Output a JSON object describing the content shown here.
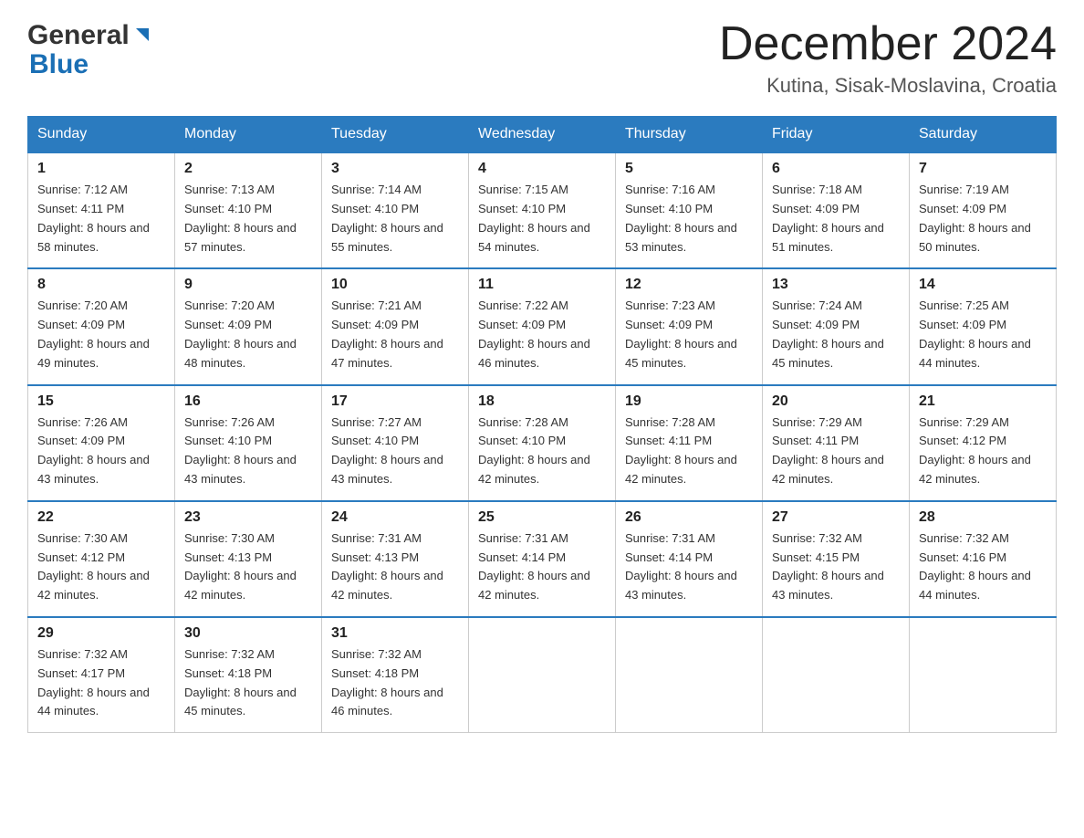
{
  "header": {
    "month_title": "December 2024",
    "location": "Kutina, Sisak-Moslavina, Croatia",
    "logo_general": "General",
    "logo_blue": "Blue"
  },
  "days_of_week": [
    "Sunday",
    "Monday",
    "Tuesday",
    "Wednesday",
    "Thursday",
    "Friday",
    "Saturday"
  ],
  "weeks": [
    [
      {
        "num": "1",
        "sunrise": "Sunrise: 7:12 AM",
        "sunset": "Sunset: 4:11 PM",
        "daylight": "Daylight: 8 hours and 58 minutes."
      },
      {
        "num": "2",
        "sunrise": "Sunrise: 7:13 AM",
        "sunset": "Sunset: 4:10 PM",
        "daylight": "Daylight: 8 hours and 57 minutes."
      },
      {
        "num": "3",
        "sunrise": "Sunrise: 7:14 AM",
        "sunset": "Sunset: 4:10 PM",
        "daylight": "Daylight: 8 hours and 55 minutes."
      },
      {
        "num": "4",
        "sunrise": "Sunrise: 7:15 AM",
        "sunset": "Sunset: 4:10 PM",
        "daylight": "Daylight: 8 hours and 54 minutes."
      },
      {
        "num": "5",
        "sunrise": "Sunrise: 7:16 AM",
        "sunset": "Sunset: 4:10 PM",
        "daylight": "Daylight: 8 hours and 53 minutes."
      },
      {
        "num": "6",
        "sunrise": "Sunrise: 7:18 AM",
        "sunset": "Sunset: 4:09 PM",
        "daylight": "Daylight: 8 hours and 51 minutes."
      },
      {
        "num": "7",
        "sunrise": "Sunrise: 7:19 AM",
        "sunset": "Sunset: 4:09 PM",
        "daylight": "Daylight: 8 hours and 50 minutes."
      }
    ],
    [
      {
        "num": "8",
        "sunrise": "Sunrise: 7:20 AM",
        "sunset": "Sunset: 4:09 PM",
        "daylight": "Daylight: 8 hours and 49 minutes."
      },
      {
        "num": "9",
        "sunrise": "Sunrise: 7:20 AM",
        "sunset": "Sunset: 4:09 PM",
        "daylight": "Daylight: 8 hours and 48 minutes."
      },
      {
        "num": "10",
        "sunrise": "Sunrise: 7:21 AM",
        "sunset": "Sunset: 4:09 PM",
        "daylight": "Daylight: 8 hours and 47 minutes."
      },
      {
        "num": "11",
        "sunrise": "Sunrise: 7:22 AM",
        "sunset": "Sunset: 4:09 PM",
        "daylight": "Daylight: 8 hours and 46 minutes."
      },
      {
        "num": "12",
        "sunrise": "Sunrise: 7:23 AM",
        "sunset": "Sunset: 4:09 PM",
        "daylight": "Daylight: 8 hours and 45 minutes."
      },
      {
        "num": "13",
        "sunrise": "Sunrise: 7:24 AM",
        "sunset": "Sunset: 4:09 PM",
        "daylight": "Daylight: 8 hours and 45 minutes."
      },
      {
        "num": "14",
        "sunrise": "Sunrise: 7:25 AM",
        "sunset": "Sunset: 4:09 PM",
        "daylight": "Daylight: 8 hours and 44 minutes."
      }
    ],
    [
      {
        "num": "15",
        "sunrise": "Sunrise: 7:26 AM",
        "sunset": "Sunset: 4:09 PM",
        "daylight": "Daylight: 8 hours and 43 minutes."
      },
      {
        "num": "16",
        "sunrise": "Sunrise: 7:26 AM",
        "sunset": "Sunset: 4:10 PM",
        "daylight": "Daylight: 8 hours and 43 minutes."
      },
      {
        "num": "17",
        "sunrise": "Sunrise: 7:27 AM",
        "sunset": "Sunset: 4:10 PM",
        "daylight": "Daylight: 8 hours and 43 minutes."
      },
      {
        "num": "18",
        "sunrise": "Sunrise: 7:28 AM",
        "sunset": "Sunset: 4:10 PM",
        "daylight": "Daylight: 8 hours and 42 minutes."
      },
      {
        "num": "19",
        "sunrise": "Sunrise: 7:28 AM",
        "sunset": "Sunset: 4:11 PM",
        "daylight": "Daylight: 8 hours and 42 minutes."
      },
      {
        "num": "20",
        "sunrise": "Sunrise: 7:29 AM",
        "sunset": "Sunset: 4:11 PM",
        "daylight": "Daylight: 8 hours and 42 minutes."
      },
      {
        "num": "21",
        "sunrise": "Sunrise: 7:29 AM",
        "sunset": "Sunset: 4:12 PM",
        "daylight": "Daylight: 8 hours and 42 minutes."
      }
    ],
    [
      {
        "num": "22",
        "sunrise": "Sunrise: 7:30 AM",
        "sunset": "Sunset: 4:12 PM",
        "daylight": "Daylight: 8 hours and 42 minutes."
      },
      {
        "num": "23",
        "sunrise": "Sunrise: 7:30 AM",
        "sunset": "Sunset: 4:13 PM",
        "daylight": "Daylight: 8 hours and 42 minutes."
      },
      {
        "num": "24",
        "sunrise": "Sunrise: 7:31 AM",
        "sunset": "Sunset: 4:13 PM",
        "daylight": "Daylight: 8 hours and 42 minutes."
      },
      {
        "num": "25",
        "sunrise": "Sunrise: 7:31 AM",
        "sunset": "Sunset: 4:14 PM",
        "daylight": "Daylight: 8 hours and 42 minutes."
      },
      {
        "num": "26",
        "sunrise": "Sunrise: 7:31 AM",
        "sunset": "Sunset: 4:14 PM",
        "daylight": "Daylight: 8 hours and 43 minutes."
      },
      {
        "num": "27",
        "sunrise": "Sunrise: 7:32 AM",
        "sunset": "Sunset: 4:15 PM",
        "daylight": "Daylight: 8 hours and 43 minutes."
      },
      {
        "num": "28",
        "sunrise": "Sunrise: 7:32 AM",
        "sunset": "Sunset: 4:16 PM",
        "daylight": "Daylight: 8 hours and 44 minutes."
      }
    ],
    [
      {
        "num": "29",
        "sunrise": "Sunrise: 7:32 AM",
        "sunset": "Sunset: 4:17 PM",
        "daylight": "Daylight: 8 hours and 44 minutes."
      },
      {
        "num": "30",
        "sunrise": "Sunrise: 7:32 AM",
        "sunset": "Sunset: 4:18 PM",
        "daylight": "Daylight: 8 hours and 45 minutes."
      },
      {
        "num": "31",
        "sunrise": "Sunrise: 7:32 AM",
        "sunset": "Sunset: 4:18 PM",
        "daylight": "Daylight: 8 hours and 46 minutes."
      },
      null,
      null,
      null,
      null
    ]
  ]
}
